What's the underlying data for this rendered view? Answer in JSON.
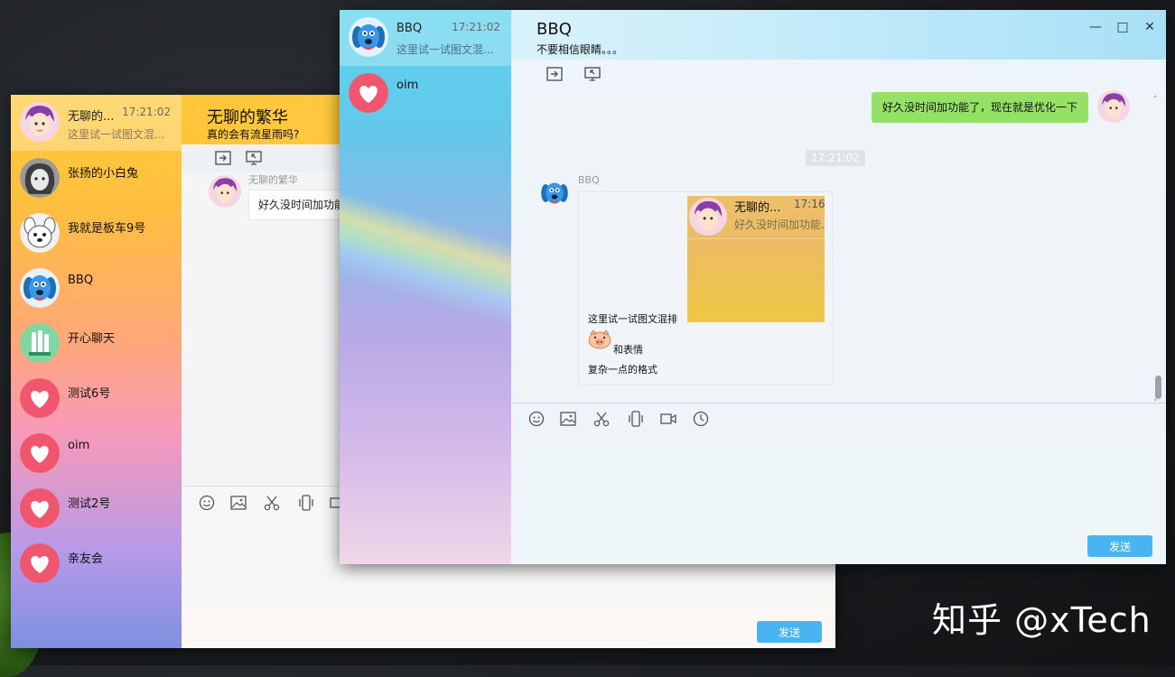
{
  "back_window": {
    "contacts": [
      {
        "name": "无聊的...",
        "time": "17:21:02",
        "preview": "这里试一试图文混...",
        "avatar": "purple-hair-boy-avatar"
      },
      {
        "name": "张扬的小白兔",
        "avatar": "girl-sketch-avatar"
      },
      {
        "name": "我就是板车9号",
        "avatar": "white-dog-avatar"
      },
      {
        "name": "BBQ",
        "avatar": "blue-dog-avatar"
      },
      {
        "name": "开心聊天",
        "avatar": "green-tooth-avatar"
      },
      {
        "name": "测试6号",
        "avatar": "heart-avatar"
      },
      {
        "name": "oim",
        "avatar": "heart-avatar"
      },
      {
        "name": "测试2号",
        "avatar": "heart-avatar"
      },
      {
        "name": "亲友会",
        "avatar": "heart-avatar"
      }
    ],
    "header": {
      "title": "无聊的繁华",
      "subtitle": "真的会有流星雨吗?"
    },
    "message": {
      "sender": "无聊的繁华",
      "text": "好久没时间加功能"
    },
    "send_label": "发送"
  },
  "front_window": {
    "contacts": [
      {
        "name": "BBQ",
        "time": "17:21:02",
        "preview": "这里试一试图文混...",
        "avatar": "blue-dog-avatar"
      },
      {
        "name": "oim",
        "avatar": "heart-avatar"
      }
    ],
    "header": {
      "title": "BBQ",
      "subtitle": "不要相信眼睛。。。"
    },
    "messages": {
      "outgoing_text": "好久没时间加功能了，现在就是优化一下",
      "time_divider": "17:21:02",
      "incoming_sender": "BBQ",
      "card": {
        "thumb_name": "无聊的...",
        "thumb_time": "17:16",
        "thumb_preview": "好久没时间加功能.",
        "line1": "这里试一试图文混排",
        "line2": "和表情",
        "line3": "复杂一点的格式"
      }
    },
    "send_label": "发送"
  },
  "watermark": "知乎 @xTech",
  "colors": {
    "send_button": "#4ab4f0",
    "outgoing_bubble": "#95e166",
    "heart_avatar": "#f0566e"
  }
}
